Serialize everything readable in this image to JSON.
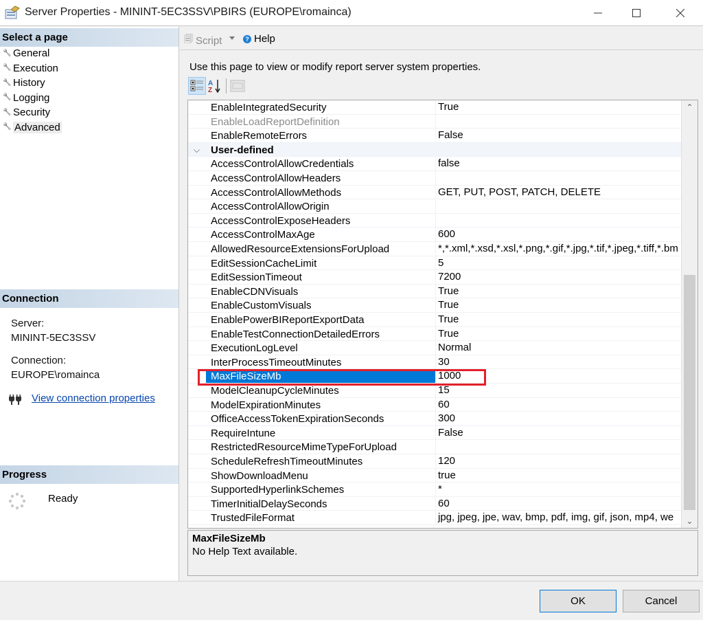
{
  "window": {
    "title": "Server Properties - MININT-5EC3SSV\\PBIRS (EUROPE\\romainca)",
    "icon": "server-properties-icon",
    "controls": [
      "minimize",
      "maximize",
      "close"
    ]
  },
  "sidebar": {
    "select_page_header": "Select a page",
    "pages": [
      {
        "label": "General",
        "active": false
      },
      {
        "label": "Execution",
        "active": false
      },
      {
        "label": "History",
        "active": false
      },
      {
        "label": "Logging",
        "active": false
      },
      {
        "label": "Security",
        "active": false
      },
      {
        "label": "Advanced",
        "active": true
      }
    ],
    "connection_header": "Connection",
    "server_label": "Server:",
    "server_value": "MININT-5EC3SSV",
    "connection_label": "Connection:",
    "connection_value": "EUROPE\\romainca",
    "view_connection_link": "View connection properties",
    "progress_header": "Progress",
    "progress_status": "Ready"
  },
  "toolbar": {
    "script_label": "Script",
    "help_label": "Help"
  },
  "main": {
    "description": "Use this page to view or modify report server system properties.",
    "grid_tools": [
      "categorized-icon",
      "alphabetical-icon",
      "property-pages-icon"
    ],
    "rows": [
      {
        "type": "property",
        "name": "EnableIntegratedSecurity",
        "value": "True"
      },
      {
        "type": "property",
        "name": "EnableLoadReportDefinition",
        "value": "",
        "disabled": true
      },
      {
        "type": "property",
        "name": "EnableRemoteErrors",
        "value": "False"
      },
      {
        "type": "category",
        "name": "User-defined",
        "value": ""
      },
      {
        "type": "property",
        "name": "AccessControlAllowCredentials",
        "value": "false"
      },
      {
        "type": "property",
        "name": "AccessControlAllowHeaders",
        "value": ""
      },
      {
        "type": "property",
        "name": "AccessControlAllowMethods",
        "value": "GET, PUT, POST, PATCH, DELETE"
      },
      {
        "type": "property",
        "name": "AccessControlAllowOrigin",
        "value": ""
      },
      {
        "type": "property",
        "name": "AccessControlExposeHeaders",
        "value": ""
      },
      {
        "type": "property",
        "name": "AccessControlMaxAge",
        "value": "600"
      },
      {
        "type": "property",
        "name": "AllowedResourceExtensionsForUpload",
        "value": "*,*.xml,*.xsd,*.xsl,*.png,*.gif,*.jpg,*.tif,*.jpeg,*.tiff,*.bm"
      },
      {
        "type": "property",
        "name": "EditSessionCacheLimit",
        "value": "5"
      },
      {
        "type": "property",
        "name": "EditSessionTimeout",
        "value": "7200"
      },
      {
        "type": "property",
        "name": "EnableCDNVisuals",
        "value": "True"
      },
      {
        "type": "property",
        "name": "EnableCustomVisuals",
        "value": "True"
      },
      {
        "type": "property",
        "name": "EnablePowerBIReportExportData",
        "value": "True"
      },
      {
        "type": "property",
        "name": "EnableTestConnectionDetailedErrors",
        "value": "True"
      },
      {
        "type": "property",
        "name": "ExecutionLogLevel",
        "value": "Normal"
      },
      {
        "type": "property",
        "name": "InterProcessTimeoutMinutes",
        "value": "30"
      },
      {
        "type": "property",
        "name": "MaxFileSizeMb",
        "value": "1000",
        "selected": true
      },
      {
        "type": "property",
        "name": "ModelCleanupCycleMinutes",
        "value": "15"
      },
      {
        "type": "property",
        "name": "ModelExpirationMinutes",
        "value": "60"
      },
      {
        "type": "property",
        "name": "OfficeAccessTokenExpirationSeconds",
        "value": "300"
      },
      {
        "type": "property",
        "name": "RequireIntune",
        "value": "False"
      },
      {
        "type": "property",
        "name": "RestrictedResourceMimeTypeForUpload",
        "value": ""
      },
      {
        "type": "property",
        "name": "ScheduleRefreshTimeoutMinutes",
        "value": "120"
      },
      {
        "type": "property",
        "name": "ShowDownloadMenu",
        "value": "true"
      },
      {
        "type": "property",
        "name": "SupportedHyperlinkSchemes",
        "value": "*"
      },
      {
        "type": "property",
        "name": "TimerInitialDelaySeconds",
        "value": "60"
      },
      {
        "type": "property",
        "name": "TrustedFileFormat",
        "value": "jpg, jpeg, jpe, wav, bmp, pdf, img, gif, json, mp4, we"
      }
    ],
    "help_title": "MaxFileSizeMb",
    "help_text": "No Help Text available."
  },
  "footer": {
    "ok_label": "OK",
    "cancel_label": "Cancel"
  },
  "colors": {
    "selection": "#0078d7",
    "highlight_box": "#e3202a",
    "link": "#0645ad",
    "section_header": "#c4d5e6"
  }
}
